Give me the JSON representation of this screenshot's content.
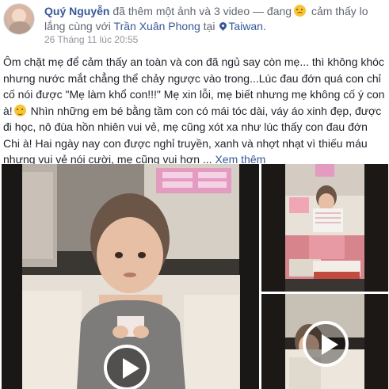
{
  "header": {
    "author": "Quý Nguyễn",
    "action_text": " đã thêm một ảnh và 3 video — đang",
    "feeling_icon": "slightly-sad-face",
    "feeling_text": " cảm thấy lo",
    "feeling_word": "lắng",
    "with_text": " cùng với ",
    "tagged_person": "Trần Xuân Phong",
    "at_text": " tại ",
    "location": "Taiwan.",
    "timestamp": "26 Tháng 11 lúc 20:55",
    "dot": " · ",
    "privacy_icon": "location-pin"
  },
  "post": {
    "text_part1": "Ôm chặt mẹ để cảm thấy an toàn và con đã ngủ say còn mẹ... thì không khóc nhưng nước mắt chẳng thể chảy ngược vào trong...Lúc đau đớn quá con chỉ cố nói được \"Mẹ làm khổ con!!!\" Mẹ xin lỗi, mẹ biết nhưng mẹ không cố ý con à!",
    "text_part2": " Nhìn những em bé bằng tầm con có mái tóc dài, váy áo xinh đẹp, được đi học, nô đùa hồn nhiên vui vẻ, mẹ cũng xót xa như lúc thấy con đau đớn Chi à! Hai ngày nay con được nghỉ truyền, xanh và nhợt nhạt vì thiếu máu nhưng vui vẻ nói cười, mẹ cũng vui hơn ... ",
    "see_more": "Xem thêm",
    "emoji": "disappointed-face"
  },
  "media": {
    "videos": [
      {
        "name": "video-main",
        "play_icon": "play-icon"
      },
      {
        "name": "video-side-top",
        "play_icon": "none"
      },
      {
        "name": "video-side-bottom",
        "play_icon": "play-icon"
      }
    ]
  },
  "colors": {
    "link": "#365899",
    "text": "#1d2129",
    "meta": "#90949c",
    "secondary": "#616770"
  }
}
